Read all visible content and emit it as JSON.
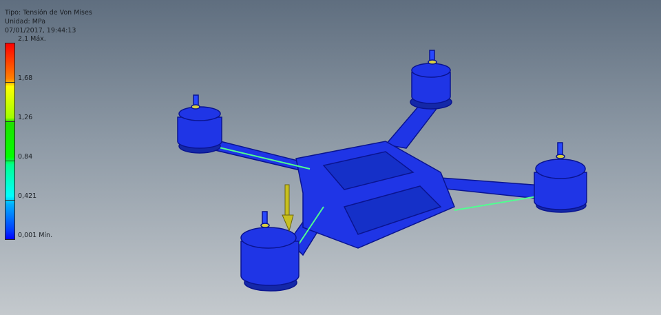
{
  "result": {
    "type": "Tipo: Tensión de Von Mises",
    "unit": "Unidad: MPa",
    "timestamp": "07/01/2017, 19:44:13"
  },
  "legend": {
    "labels": [
      "2,1 Máx.",
      "1,68",
      "1,26",
      "0,84",
      "0,421",
      "0,001 Mín."
    ],
    "max": 2.1,
    "min": 0.001,
    "colors": [
      "#ff0000",
      "#ffff00",
      "#00ff00",
      "#00ffff",
      "#0000ff"
    ]
  },
  "model": {
    "body_color": "#1f35e6",
    "load_arrow_color": "#c8c020"
  }
}
